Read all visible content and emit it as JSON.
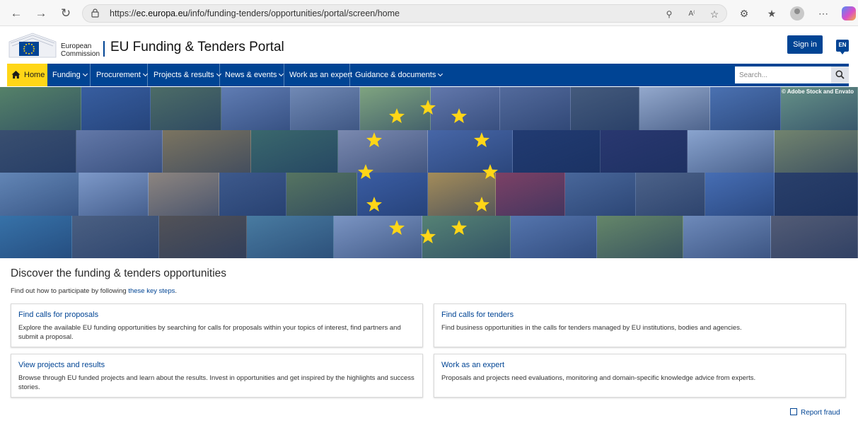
{
  "browser": {
    "url_prefix": "https://",
    "url_host": "ec.europa.eu",
    "url_path": "/info/funding-tenders/opportunities/portal/screen/home"
  },
  "header": {
    "ec_line1": "European",
    "ec_line2": "Commission",
    "portal_title": "EU Funding & Tenders Portal",
    "signin_label": "Sign in",
    "lang_label": "EN"
  },
  "nav": {
    "home": "Home",
    "funding": "Funding",
    "procurement": "Procurement",
    "projects": "Projects & results",
    "news": "News & events",
    "expert": "Work as an expert",
    "guidance": "Guidance & documents",
    "search_placeholder": "Search..."
  },
  "hero": {
    "credit": "© Adobe Stock and Envato"
  },
  "content": {
    "title": "Discover the funding & tenders opportunities",
    "intro_text": "Find out how to participate by following ",
    "intro_link": "these key steps",
    "intro_end": "."
  },
  "cards": [
    {
      "title": "Find calls for proposals",
      "desc": "Explore the available EU funding opportunities by searching for calls for proposals within your topics of interest, find partners and submit a proposal."
    },
    {
      "title": "Find calls for tenders",
      "desc": "Find business opportunities in the calls for tenders managed by EU institutions, bodies and agencies."
    },
    {
      "title": "View projects and results",
      "desc": "Browse through EU funded projects and learn about the results. Invest in opportunities and get inspired by the highlights and success stories."
    },
    {
      "title": "Work as an expert",
      "desc": "Proposals and projects need evaluations, monitoring and domain-specific knowledge advice from experts."
    }
  ],
  "footer": {
    "report_fraud": "Report fraud"
  },
  "colors": {
    "brand_blue": "#004494",
    "home_yellow": "#ffd617",
    "star_yellow": "#ffd617"
  }
}
